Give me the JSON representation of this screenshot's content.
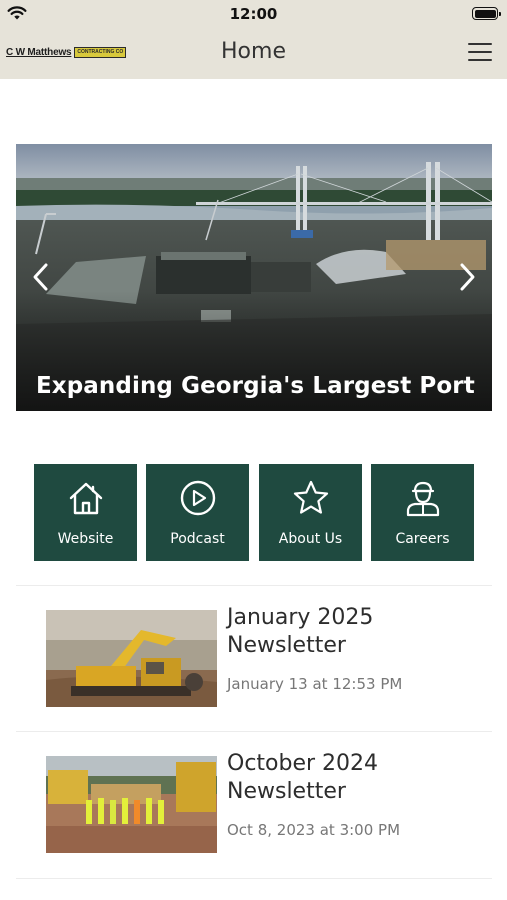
{
  "status_bar": {
    "time": "12:00"
  },
  "header": {
    "logo_text": "C W Matthews",
    "logo_tag": "CONTRACTING CO",
    "title": "Home"
  },
  "hero": {
    "caption": "Expanding Georgia's Largest Port"
  },
  "tiles": [
    {
      "label": "Website",
      "icon": "home-icon"
    },
    {
      "label": "Podcast",
      "icon": "play-circle-icon"
    },
    {
      "label": "About Us",
      "icon": "star-icon"
    },
    {
      "label": "Careers",
      "icon": "worker-icon"
    }
  ],
  "news": [
    {
      "title_line1": "January 2025",
      "title_line2": "Newsletter",
      "date": "January 13 at 12:53 PM"
    },
    {
      "title_line1": "October 2024",
      "title_line2": "Newsletter",
      "date": "Oct 8, 2023 at 3:00 PM"
    }
  ],
  "colors": {
    "topbar": "#e6e3d9",
    "tile": "#1f4a40",
    "logo_tag": "#d8c93c"
  }
}
